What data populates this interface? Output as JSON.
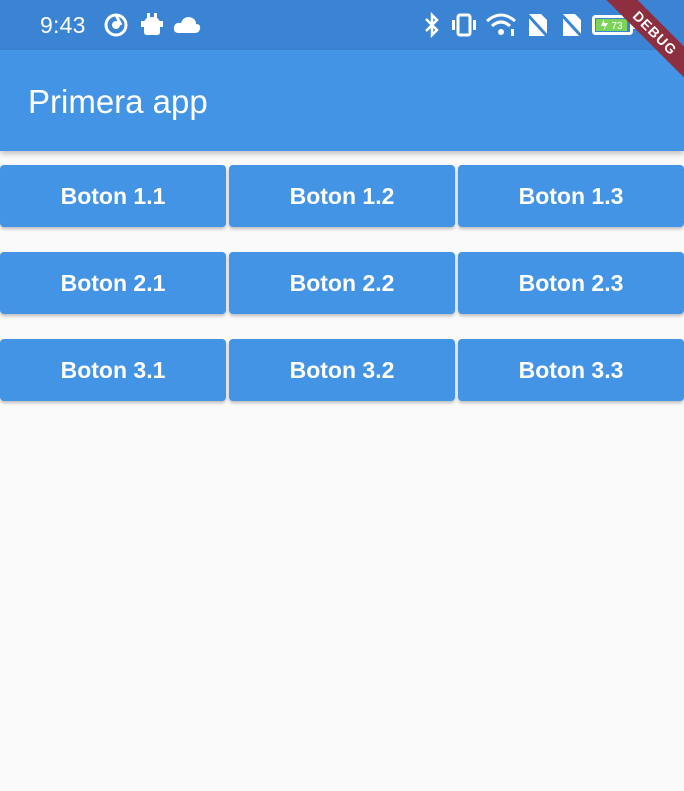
{
  "status_bar": {
    "time": "9:43",
    "left_icons": [
      "sync-icon",
      "android-debug-icon",
      "cloud-icon"
    ],
    "right_icons": [
      "bluetooth-icon",
      "vibrate-icon",
      "wifi-icon",
      "no-sim-icon",
      "no-sim-icon",
      "battery-icon"
    ],
    "battery_level": "73",
    "battery_color": "#7bd35a"
  },
  "app_bar": {
    "title": "Primera app",
    "color": "#4494e6"
  },
  "debug_banner": {
    "label": "DEBUG",
    "color": "#8d2f3f"
  },
  "buttons": {
    "rows": [
      [
        "Boton 1.1",
        "Boton 1.2",
        "Boton 1.3"
      ],
      [
        "Boton 2.1",
        "Boton 2.2",
        "Boton 2.3"
      ],
      [
        "Boton 3.1",
        "Boton 3.2",
        "Boton 3.3"
      ]
    ],
    "color": "#4494e6"
  }
}
